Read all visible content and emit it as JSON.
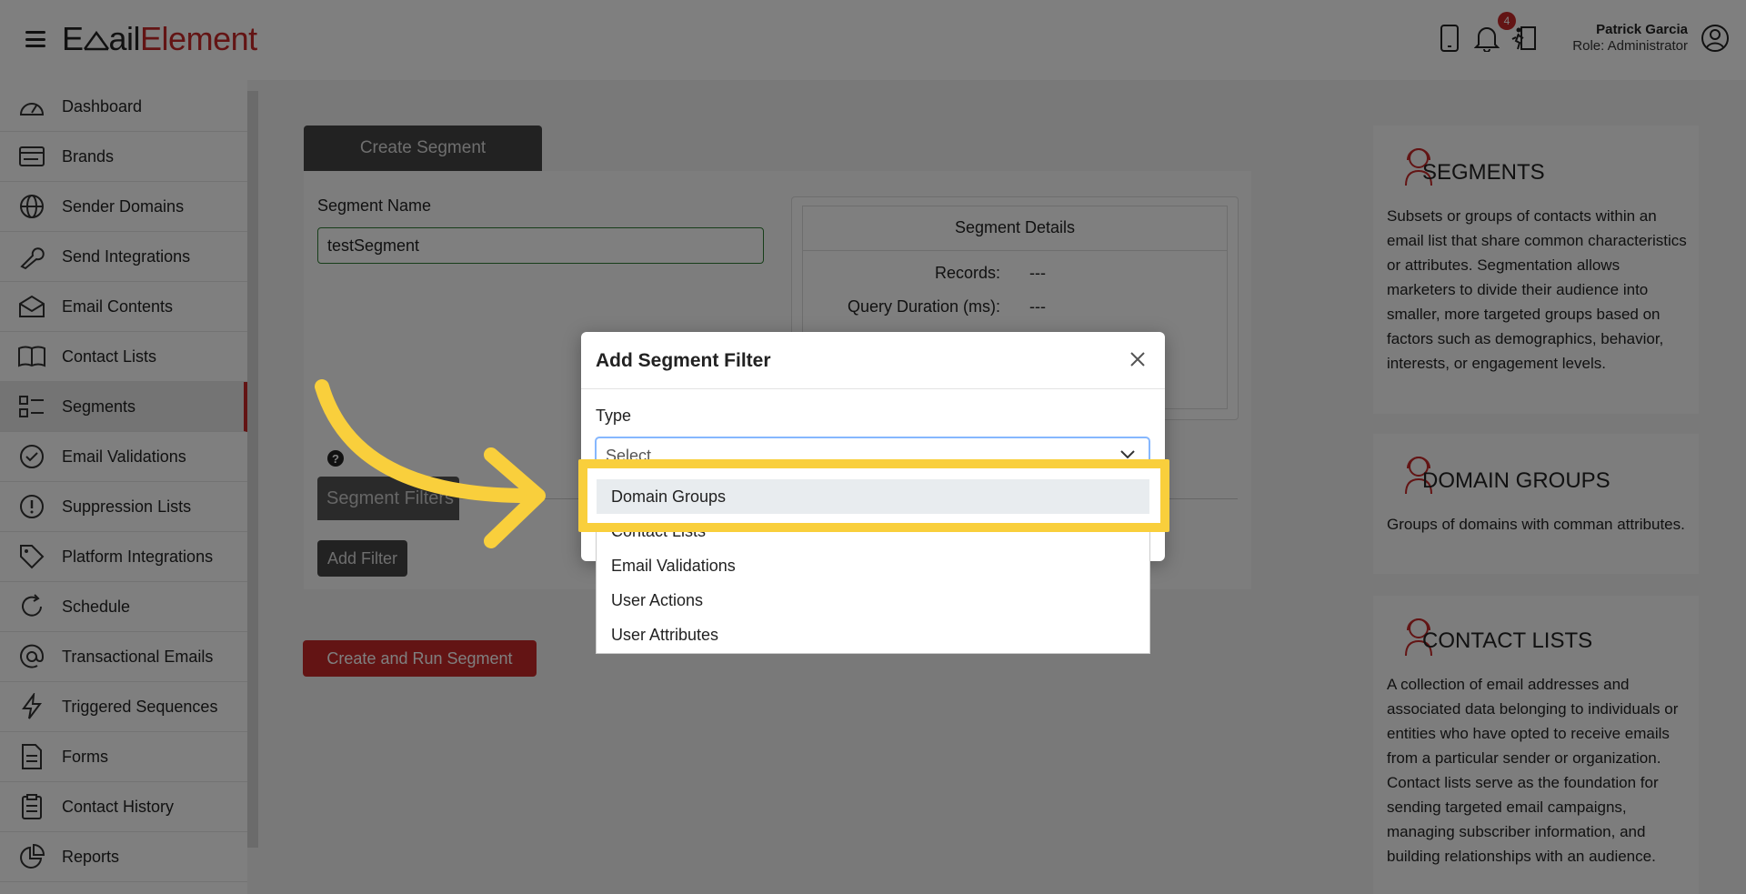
{
  "header": {
    "logo_part1": "E",
    "logo_part1b": "ail",
    "logo_part2": "Element",
    "notification_count": "4",
    "user_name": "Patrick Garcia",
    "user_role": "Role: Administrator"
  },
  "sidebar": {
    "items": [
      {
        "label": "Dashboard",
        "icon": "dashboard-icon"
      },
      {
        "label": "Brands",
        "icon": "brands-icon"
      },
      {
        "label": "Sender Domains",
        "icon": "globe-icon"
      },
      {
        "label": "Send Integrations",
        "icon": "wrench-icon"
      },
      {
        "label": "Email Contents",
        "icon": "envelope-icon"
      },
      {
        "label": "Contact Lists",
        "icon": "book-icon"
      },
      {
        "label": "Segments",
        "icon": "list-icon"
      },
      {
        "label": "Email Validations",
        "icon": "check-circle-icon"
      },
      {
        "label": "Suppression Lists",
        "icon": "exclamation-icon"
      },
      {
        "label": "Platform Integrations",
        "icon": "tag-icon"
      },
      {
        "label": "Schedule",
        "icon": "refresh-icon"
      },
      {
        "label": "Transactional Emails",
        "icon": "at-icon"
      },
      {
        "label": "Triggered Sequences",
        "icon": "bolt-icon"
      },
      {
        "label": "Forms",
        "icon": "document-icon"
      },
      {
        "label": "Contact History",
        "icon": "clipboard-icon"
      },
      {
        "label": "Reports",
        "icon": "pie-chart-icon"
      }
    ]
  },
  "main": {
    "tab_label": "Create Segment",
    "segment_name_label": "Segment Name",
    "segment_name_value": "testSegment",
    "details_title": "Segment Details",
    "records_label": "Records:",
    "records_value": "---",
    "query_duration_label": "Query Duration (ms):",
    "query_duration_value": "---",
    "segment_filters_label": "Segment Filters",
    "add_filter_label": "Add Filter",
    "create_run_label": "Create and Run Segment"
  },
  "info": {
    "segments_title": "SEGMENTS",
    "segments_text": "Subsets or groups of contacts within an email list that share common characteristics or attributes. Segmentation allows marketers to divide their audience into smaller, more targeted groups based on factors such as demographics, behavior, interests, or engagement levels.",
    "domain_groups_title": "DOMAIN GROUPS",
    "domain_groups_text": "Groups of domains with comman attributes.",
    "contact_lists_title": "CONTACT LISTS",
    "contact_lists_text": "A collection of email addresses and associated data belonging to individuals or entities who have opted to receive emails from a particular sender or organization. Contact lists serve as the foundation for sending targeted email campaigns, managing subscriber information, and building relationships with an audience."
  },
  "modal": {
    "title": "Add Segment Filter",
    "type_label": "Type",
    "select_placeholder": "Select",
    "options": [
      "Domain Groups",
      "Contact Lists",
      "Email Validations",
      "User Actions",
      "User Attributes"
    ]
  },
  "colors": {
    "accent": "#c62828",
    "highlight": "#f9cf3c",
    "focus": "#86b7fe"
  }
}
